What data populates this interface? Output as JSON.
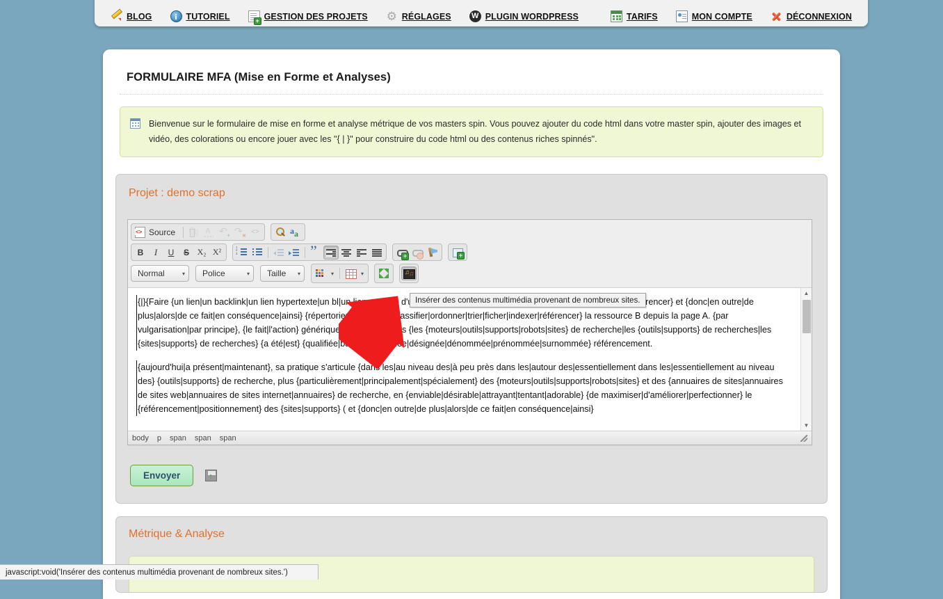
{
  "colors": {
    "page_background": "#7ba7be",
    "accent_orange": "#e0702a",
    "banner_green_bg": "#f0f7d4",
    "banner_green_border": "#d3e09a",
    "submit_green": "#b6ecc9",
    "arrow_red": "#ee1c1c"
  },
  "topnav": {
    "left_items": [
      {
        "label": "BLOG",
        "icon": "pencil-icon"
      },
      {
        "label": "TUTORIEL",
        "icon": "info-icon"
      },
      {
        "label": "GESTION DES PROJETS",
        "icon": "notepad-add-icon"
      },
      {
        "label": "RÉGLAGES",
        "icon": "gear-icon"
      },
      {
        "label": "PLUGIN WORDPRESS",
        "icon": "wordpress-icon"
      }
    ],
    "right_items": [
      {
        "label": "TARIFS",
        "icon": "calendar-icon"
      },
      {
        "label": "MON COMPTE",
        "icon": "id-card-icon"
      },
      {
        "label": "DÉCONNEXION",
        "icon": "red-x-icon"
      }
    ]
  },
  "page": {
    "title": "FORMULAIRE MFA (Mise en Forme et Analyses)",
    "info_banner": {
      "icon": "info-panel-icon",
      "text": "Bienvenue sur le formulaire de mise en forme et analyse métrique de vos masters spin. Vous pouvez ajouter du code html dans votre master spin, ajouter des images et vidéo, des colorations ou encore jouer avec les \"{ | }\" pour construire du code html ou des contenus riches spinnés\"."
    }
  },
  "project_panel": {
    "title": "Projet : demo scrap"
  },
  "editor": {
    "toolbar": {
      "row1": {
        "source_label": "Source",
        "buttons": [
          {
            "name": "find-replace-button",
            "icon": "binoculars-icon",
            "state": "disabled"
          },
          {
            "name": "spellcheck-button",
            "icon": "spellcheck-icon",
            "state": "disabled"
          },
          {
            "name": "undo-button",
            "icon": "undo-icon",
            "state": "disabled"
          },
          {
            "name": "redo-button",
            "icon": "redo-icon",
            "state": "disabled"
          },
          {
            "name": "show-blocks-button",
            "icon": "code-brackets-icon",
            "state": "disabled"
          }
        ],
        "group2": [
          {
            "name": "search-button",
            "icon": "magnifier-icon",
            "state": "enabled"
          },
          {
            "name": "abbreviation-button",
            "icon": "abbr-aa-icon",
            "state": "enabled"
          }
        ]
      },
      "row2": {
        "format_buttons": [
          {
            "name": "bold-button",
            "label": "B",
            "icon": "bold-icon"
          },
          {
            "name": "italic-button",
            "label": "I",
            "icon": "italic-icon"
          },
          {
            "name": "underline-button",
            "label": "U",
            "icon": "underline-icon"
          },
          {
            "name": "strikethrough-button",
            "label": "S",
            "icon": "strikethrough-icon"
          },
          {
            "name": "subscript-button",
            "label": "X₂",
            "icon": "subscript-icon"
          },
          {
            "name": "superscript-button",
            "label": "X²",
            "icon": "superscript-icon"
          }
        ],
        "list_buttons": [
          {
            "name": "numbered-list-button",
            "icon": "ordered-list-icon"
          },
          {
            "name": "bulleted-list-button",
            "icon": "unordered-list-icon"
          },
          {
            "name": "outdent-button",
            "icon": "outdent-icon",
            "state": "disabled"
          },
          {
            "name": "indent-button",
            "icon": "indent-icon"
          },
          {
            "name": "blockquote-button",
            "icon": "quote-icon"
          },
          {
            "name": "align-left-button",
            "icon": "align-left-icon",
            "state": "active"
          },
          {
            "name": "align-center-button",
            "icon": "align-center-icon"
          },
          {
            "name": "align-right-button",
            "icon": "align-right-icon"
          },
          {
            "name": "align-justify-button",
            "icon": "align-justify-icon"
          }
        ],
        "link_buttons": [
          {
            "name": "insert-link-button",
            "icon": "link-add-icon"
          },
          {
            "name": "unlink-button",
            "icon": "unlink-icon",
            "state": "disabled"
          },
          {
            "name": "anchor-button",
            "icon": "anchor-flag-icon"
          }
        ],
        "image_buttons": [
          {
            "name": "insert-image-button",
            "icon": "image-add-icon"
          }
        ]
      },
      "row3": {
        "dropdowns": [
          {
            "name": "paragraph-format-select",
            "value": "Normal"
          },
          {
            "name": "font-family-select",
            "value": "Police"
          },
          {
            "name": "font-size-select",
            "value": "Taille"
          }
        ],
        "split_buttons": [
          {
            "name": "text-color-button",
            "icon": "color-palette-icon"
          },
          {
            "name": "table-button",
            "icon": "table-icon"
          }
        ],
        "extra_buttons": [
          {
            "name": "maximize-button",
            "icon": "maximize-icon"
          },
          {
            "name": "insert-media-button",
            "icon": "media-embed-icon",
            "state": "active"
          }
        ]
      }
    },
    "content": {
      "paragraph1": "{|}{Faire {un lien|un backlink|un lien hypertexte|un bl|un lien majeur} d'une page A vers une ressource B, c'est {y faire référence|référencer} et {donc|en outre|de plus|alors|de ce fait|en conséquence|ainsi} {répertorier|inventorier|classifier|ordonner|trier|ficher|indexer|référencer} la ressource B depuis la page A. {par vulgarisation|par principe}, {le fait|l'action} générique description dans {les {moteurs|outils|supports|robots|sites} de recherche|les {outils|supports} de recherches|les {sites|supports} de recherches} {a été|est} {qualifiée|baptisée|appelée|désignée|dénommée|prénommée|surnommée} référencement.",
      "paragraph2": "{aujourd'hui|a présent|maintenant}, sa pratique s'articule {dans les|au niveau des|à peu près dans les|autour des|essentiellement dans les|essentiellement au niveau des} {outils|supports} de recherche, plus {particulièrement|principalement|spécialement} des {moteurs|outils|supports|robots|sites} et des {annuaires de sites|annuaires de sites web|annuaires de sites internet|annuaires} de recherche, en {enviable|désirable|attrayant|tentant|adorable} {de maximiser|d'améliorer|perfectionner} le {référencement|positionnement} des {sites|supports} ( et {donc|en outre|de plus|alors|de ce fait|en conséquence|ainsi}"
    },
    "element_path": [
      "body",
      "p",
      "span",
      "span",
      "span"
    ],
    "scrollbar": {
      "up_arrow": "▲",
      "down_arrow": "▼"
    }
  },
  "submit": {
    "button_label": "Envoyer",
    "save_icon": "save-floppy-icon"
  },
  "metric_panel": {
    "title": "Métrique & Analyse"
  },
  "tooltip": {
    "text": "Insérer des contenus multimédia provenant de nombreux sites."
  },
  "status_bar": {
    "text": "javascript:void('Insérer des contenus multimédia provenant de nombreux sites.')"
  }
}
